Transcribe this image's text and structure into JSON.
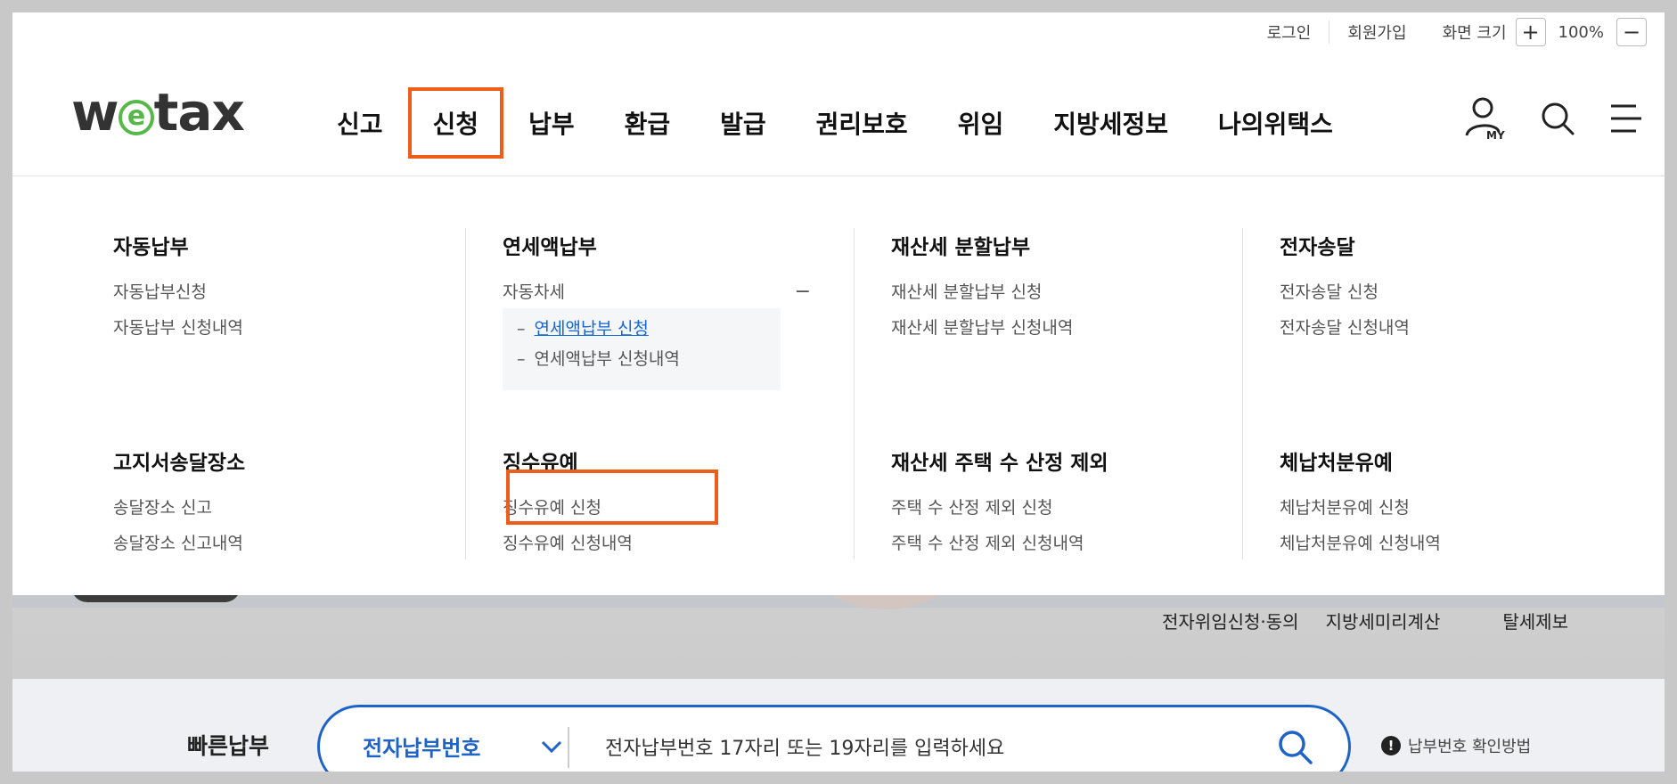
{
  "util": {
    "login": "로그인",
    "signup": "회원가입",
    "screen_size": "화면 크기",
    "zoom_in": "+",
    "zoom_level": "100%",
    "zoom_out": "−"
  },
  "logo": {
    "prefix": "w",
    "e": "e",
    "suffix": "tax"
  },
  "gnb": [
    {
      "label": "신고"
    },
    {
      "label": "신청"
    },
    {
      "label": "납부"
    },
    {
      "label": "환급"
    },
    {
      "label": "발급"
    },
    {
      "label": "권리보호"
    },
    {
      "label": "위임"
    },
    {
      "label": "지방세정보"
    },
    {
      "label": "나의위택스"
    }
  ],
  "header_icons": {
    "my_label": "MY"
  },
  "menu": {
    "auto_pay": {
      "title": "자동납부",
      "links": [
        "자동납부신청",
        "자동납부 신청내역"
      ]
    },
    "annual_pay": {
      "title": "연세액납부",
      "sub_title": "자동차세",
      "toggle": "−",
      "sub_items": [
        "연세액납부 신청",
        "연세액납부 신청내역"
      ],
      "dash": "–"
    },
    "property_split": {
      "title": "재산세 분할납부",
      "links": [
        "재산세 분할납부 신청",
        "재산세 분할납부 신청내역"
      ]
    },
    "e_delivery": {
      "title": "전자송달",
      "links": [
        "전자송달 신청",
        "전자송달 신청내역"
      ]
    },
    "notice_place": {
      "title": "고지서송달장소",
      "links": [
        "송달장소 신고",
        "송달장소 신고내역"
      ]
    },
    "collection_defer": {
      "title": "징수유예",
      "links": [
        "징수유예 신청",
        "징수유예 신청내역"
      ]
    },
    "house_exclude": {
      "title": "재산세 주택 수 산정 제외",
      "links": [
        "주택 수 산정 제외 신청",
        "주택 수 산정 제외 신청내역"
      ]
    },
    "disposition_defer": {
      "title": "체납처분유예",
      "links": [
        "체납처분유예 신청",
        "체납처분유예 신청내역"
      ]
    }
  },
  "quick_links": [
    "전자위임신청·동의",
    "지방세미리계산",
    "탈세제보"
  ],
  "fast_pay": {
    "label": "빠른납부",
    "select_value": "전자납부번호",
    "placeholder": "전자납부번호 17자리 또는 19자리를 입력하세요",
    "help": "납부번호 확인방법",
    "help_icon": "!"
  },
  "colors": {
    "accent": "#ee5e1b",
    "brand_blue": "#1d63c8",
    "logo_green": "#55b848"
  }
}
